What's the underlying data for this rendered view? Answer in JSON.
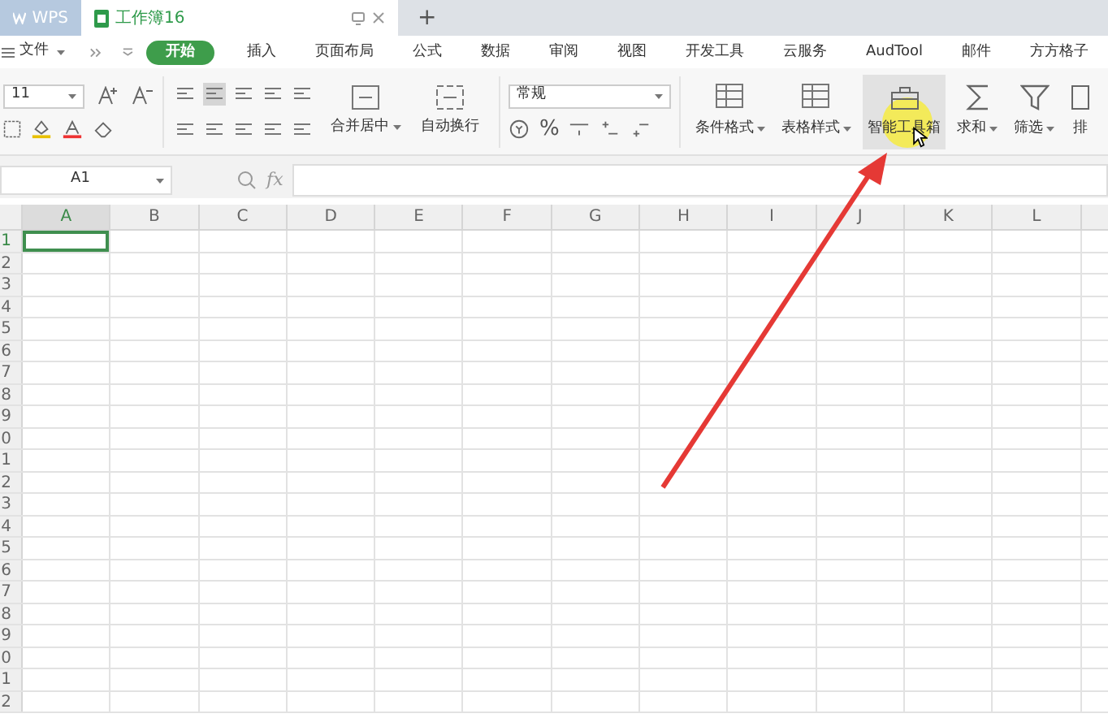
{
  "tabs": [
    {
      "label": "WPS",
      "kind": "app",
      "selected": false
    },
    {
      "label": "工作簿16",
      "kind": "doc",
      "selected": true
    }
  ],
  "new_tab": "+",
  "menu": {
    "file": "文件",
    "tabs": [
      {
        "label": "开始",
        "selected": true
      },
      {
        "label": "插入",
        "selected": false
      },
      {
        "label": "页面布局",
        "selected": false
      },
      {
        "label": "公式",
        "selected": false
      },
      {
        "label": "数据",
        "selected": false
      },
      {
        "label": "审阅",
        "selected": false
      },
      {
        "label": "视图",
        "selected": false
      },
      {
        "label": "开发工具",
        "selected": false
      },
      {
        "label": "云服务",
        "selected": false
      },
      {
        "label": "AudTool",
        "selected": false
      },
      {
        "label": "邮件",
        "selected": false
      },
      {
        "label": "方方格子",
        "selected": false
      }
    ]
  },
  "font_size": "11",
  "merge_buttons": [
    {
      "label": "合并居中",
      "caret": true
    },
    {
      "label": "自动换行",
      "caret": false
    }
  ],
  "number_format": "常规",
  "percent": "%",
  "tool_buttons": [
    {
      "label": "条件格式",
      "caret": true,
      "highlighted": false,
      "kind": "table"
    },
    {
      "label": "表格样式",
      "caret": true,
      "highlighted": false,
      "kind": "table"
    },
    {
      "label": "智能工具箱",
      "caret": false,
      "highlighted": true,
      "kind": "toolbox"
    },
    {
      "label": "求和",
      "caret": true,
      "highlighted": false,
      "kind": "sum"
    },
    {
      "label": "筛选",
      "caret": true,
      "highlighted": false,
      "kind": "filter"
    },
    {
      "label": "排",
      "caret": false,
      "highlighted": false,
      "kind": "sort"
    }
  ],
  "name_box": "A1",
  "fx": "fx",
  "columns": [
    {
      "label": "A",
      "selected": true
    },
    {
      "label": "B",
      "selected": false
    },
    {
      "label": "C",
      "selected": false
    },
    {
      "label": "D",
      "selected": false
    },
    {
      "label": "E",
      "selected": false
    },
    {
      "label": "F",
      "selected": false
    },
    {
      "label": "G",
      "selected": false
    },
    {
      "label": "H",
      "selected": false
    },
    {
      "label": "I",
      "selected": false
    },
    {
      "label": "J",
      "selected": false
    },
    {
      "label": "K",
      "selected": false
    },
    {
      "label": "L",
      "selected": false
    }
  ],
  "rows": [
    {
      "label": "1",
      "selected": true
    },
    {
      "label": "2",
      "selected": false
    },
    {
      "label": "3",
      "selected": false
    },
    {
      "label": "4",
      "selected": false
    },
    {
      "label": "5",
      "selected": false
    },
    {
      "label": "6",
      "selected": false
    },
    {
      "label": "7",
      "selected": false
    },
    {
      "label": "8",
      "selected": false
    },
    {
      "label": "9",
      "selected": false
    },
    {
      "label": "0",
      "selected": false
    },
    {
      "label": "1",
      "selected": false
    },
    {
      "label": "2",
      "selected": false
    },
    {
      "label": "3",
      "selected": false
    },
    {
      "label": "4",
      "selected": false
    },
    {
      "label": "5",
      "selected": false
    },
    {
      "label": "6",
      "selected": false
    },
    {
      "label": "7",
      "selected": false
    },
    {
      "label": "8",
      "selected": false
    },
    {
      "label": "9",
      "selected": false
    },
    {
      "label": "0",
      "selected": false
    },
    {
      "label": "1",
      "selected": false
    },
    {
      "label": "2",
      "selected": false
    }
  ]
}
